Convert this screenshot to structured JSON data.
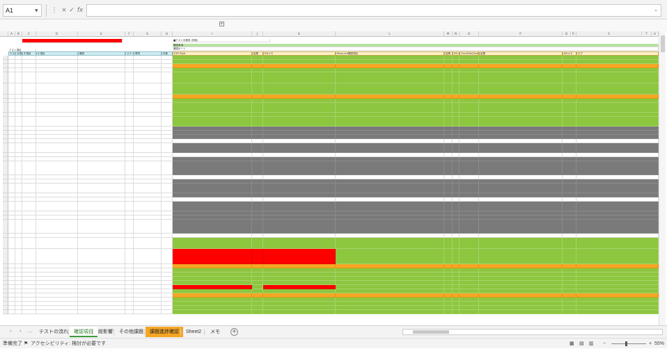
{
  "formula_bar": {
    "name_box": "A1",
    "cancel_icon": "×",
    "confirm_icon": "✓",
    "function_icon": "fx"
  },
  "sheet": {
    "red_title_text": "",
    "note_left": "テスト項目",
    "note_top": "■テスト手順書 (詳細)",
    "header_right_1": "確認事項",
    "header_right_2": "確認ポート",
    "columns": [
      "A",
      "B",
      "C",
      "D",
      "E",
      "F",
      "G",
      "H",
      "I",
      "J",
      "K",
      "L",
      "M",
      "N",
      "O",
      "P",
      "Q",
      "R",
      "S",
      "T",
      "U",
      "V"
    ],
    "left_headers": [
      "テスト",
      "大項目",
      "中項目",
      "小項目",
      "確認",
      "ステータス",
      "環境",
      "対象"
    ],
    "right_headers": [
      "Cliff Topic",
      "結果",
      "NGメモ",
      "Resource確認項目",
      "結果",
      "NGメモ",
      "CloudTrail/Audit Topic",
      "結果",
      "NGメモ",
      "ログ"
    ]
  },
  "tabs": {
    "items": [
      "テストの流れ",
      "確認項目",
      "総影響",
      "その他課題",
      "課題進捗確認",
      "Sheet2",
      "メモ"
    ],
    "active": "確認項目",
    "highlighted": "課題進捗確認",
    "add_label": "+"
  },
  "status_bar": {
    "ready": "準備完了",
    "accessibility": "アクセシビリティ: 検討が必要です",
    "zoom": "55%"
  },
  "colors": {
    "green": "#8dc63f",
    "orange": "#f5a623",
    "red": "#ff0000",
    "gray": "#7a7a7a"
  }
}
